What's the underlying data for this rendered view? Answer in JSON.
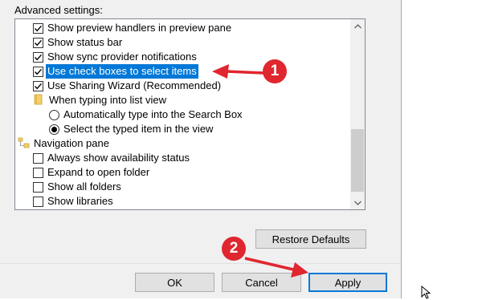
{
  "advanced_settings_label": "Advanced settings:",
  "items": [
    {
      "type": "checkbox",
      "label": "Show preview handlers in preview pane",
      "checked": true
    },
    {
      "type": "checkbox",
      "label": "Show status bar",
      "checked": true
    },
    {
      "type": "checkbox",
      "label": "Show sync provider notifications",
      "checked": true
    },
    {
      "type": "checkbox",
      "label": "Use check boxes to select items",
      "checked": true,
      "selected": true
    },
    {
      "type": "checkbox",
      "label": "Use Sharing Wizard (Recommended)",
      "checked": true
    },
    {
      "type": "folder",
      "label": "When typing into list view"
    },
    {
      "type": "radio",
      "label": "Automatically type into the Search Box",
      "checked": false
    },
    {
      "type": "radio",
      "label": "Select the typed item in the view",
      "checked": true
    },
    {
      "type": "folder",
      "label": "Navigation pane"
    },
    {
      "type": "checkbox",
      "label": "Always show availability status",
      "checked": false
    },
    {
      "type": "checkbox",
      "label": "Expand to open folder",
      "checked": false
    },
    {
      "type": "checkbox",
      "label": "Show all folders",
      "checked": false
    },
    {
      "type": "checkbox",
      "label": "Show libraries",
      "checked": false
    }
  ],
  "buttons": {
    "restore_defaults": "Restore Defaults",
    "ok": "OK",
    "cancel": "Cancel",
    "apply": "Apply"
  },
  "annotations": {
    "badge1": "1",
    "badge2": "2",
    "color": "#e0262f"
  },
  "icons": {
    "check": "checkmark-icon",
    "folder": "folder-icon",
    "nav_pane": "navigation-pane-icon",
    "scroll_up": "chevron-up-icon",
    "scroll_down": "chevron-down-icon",
    "cursor": "mouse-cursor-icon"
  }
}
